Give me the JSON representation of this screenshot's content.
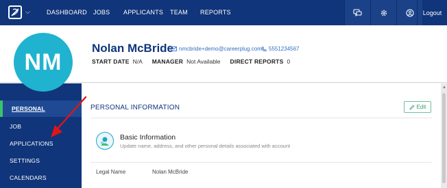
{
  "nav": {
    "items": [
      "DASHBOARD",
      "JOBS",
      "APPLICANTS",
      "TEAM",
      "REPORTS"
    ],
    "icons": [
      "chat-icon",
      "gear-icon",
      "user-circle-icon"
    ],
    "logout": "Logout"
  },
  "profile": {
    "initials": "NM",
    "name": "Nolan McBride",
    "email": "nmcbride+demo@careerplug.com",
    "phone": "5551234567",
    "meta": [
      {
        "key": "START DATE",
        "value": "N/A"
      },
      {
        "key": "MANAGER",
        "value": "Not Available"
      },
      {
        "key": "DIRECT REPORTS",
        "value": "0"
      }
    ],
    "avatar_color": "#1fb3cf"
  },
  "sidebar": {
    "items": [
      {
        "label": "PERSONAL",
        "active": true
      },
      {
        "label": "JOB",
        "active": false
      },
      {
        "label": "APPLICATIONS",
        "active": false
      },
      {
        "label": "SETTINGS",
        "active": false
      },
      {
        "label": "CALENDARS",
        "active": false
      }
    ]
  },
  "main": {
    "section_title": "PERSONAL INFORMATION",
    "edit_label": "Edit",
    "basic": {
      "title": "Basic Information",
      "subtitle": "Update name, address, and other personal details associated with account"
    },
    "fields": [
      {
        "label": "Legal Name",
        "value": "Nolan McBride"
      }
    ]
  },
  "colors": {
    "nav_bg": "#10357a",
    "accent_green": "#39c46b",
    "link_blue": "#2f6fc0",
    "annotation_red": "#e0141b"
  }
}
